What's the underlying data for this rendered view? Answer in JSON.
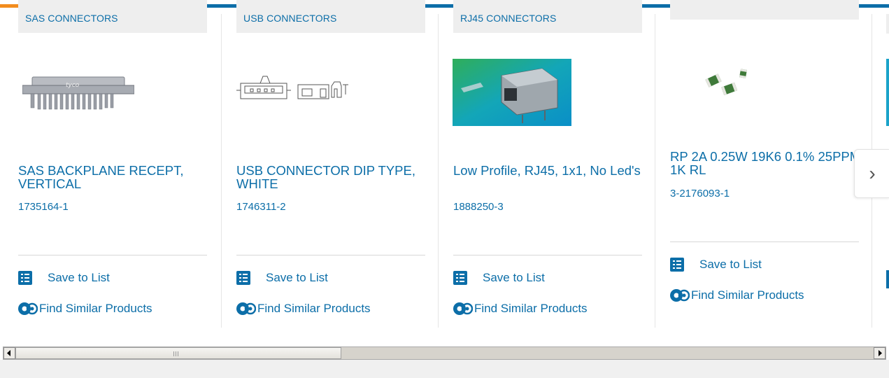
{
  "cards": [
    {
      "category": "SAS CONNECTORS",
      "title": "SAS BACKPLANE RECEPT, VERTICAL",
      "part_number": "1735164-1",
      "save_label": "Save to List",
      "similar_label": "Find Similar Products",
      "image_icon": "sas-connector-image"
    },
    {
      "category": "USB CONNECTORS",
      "title": "USB CONNECTOR DIP TYPE, WHITE",
      "part_number": "1746311-2",
      "save_label": "Save to List",
      "similar_label": "Find Similar Products",
      "image_icon": "usb-connector-drawing"
    },
    {
      "category": "RJ45 CONNECTORS",
      "title": "Low Profile, RJ45, 1x1, No Led's",
      "part_number": "1888250-3",
      "save_label": "Save to List",
      "similar_label": "Find Similar Products",
      "image_icon": "rj45-connector-photo"
    },
    {
      "category": "",
      "title": "RP 2A 0.25W 19K6 0.1% 25PPM 1K RL",
      "part_number": "3-2176093-1",
      "save_label": "Save to List",
      "similar_label": "Find Similar Products",
      "image_icon": "chip-resistor-photo"
    }
  ],
  "next_arrow": "›",
  "colors": {
    "link": "#0c6ea8",
    "tab_background": "#eeeeee",
    "top_accent": "#f28c1e"
  }
}
